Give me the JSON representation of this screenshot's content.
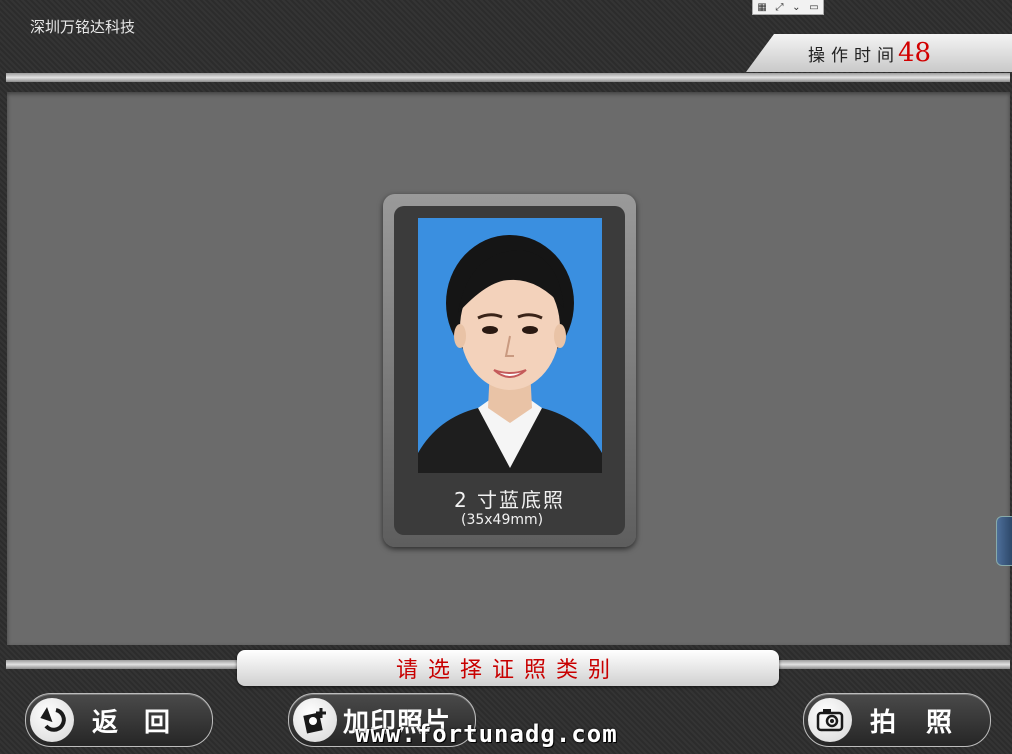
{
  "header": {
    "company": "深圳万铭达科技",
    "operation_time_label": "操作时间",
    "operation_time_value": "48"
  },
  "card": {
    "title": "2 寸蓝底照",
    "size": "(35x49mm)",
    "background_color": "#3a8fe0"
  },
  "prompt": {
    "text": "请选择证照类别",
    "color": "#c80000"
  },
  "buttons": {
    "back_label": "返回",
    "add_photo_label": "加印照片",
    "take_photo_label": "拍照"
  },
  "watermark": "www.fortunadg.com",
  "icons": {
    "back": "back-arrow-icon",
    "add_photo": "add-photo-icon",
    "camera": "camera-icon"
  }
}
